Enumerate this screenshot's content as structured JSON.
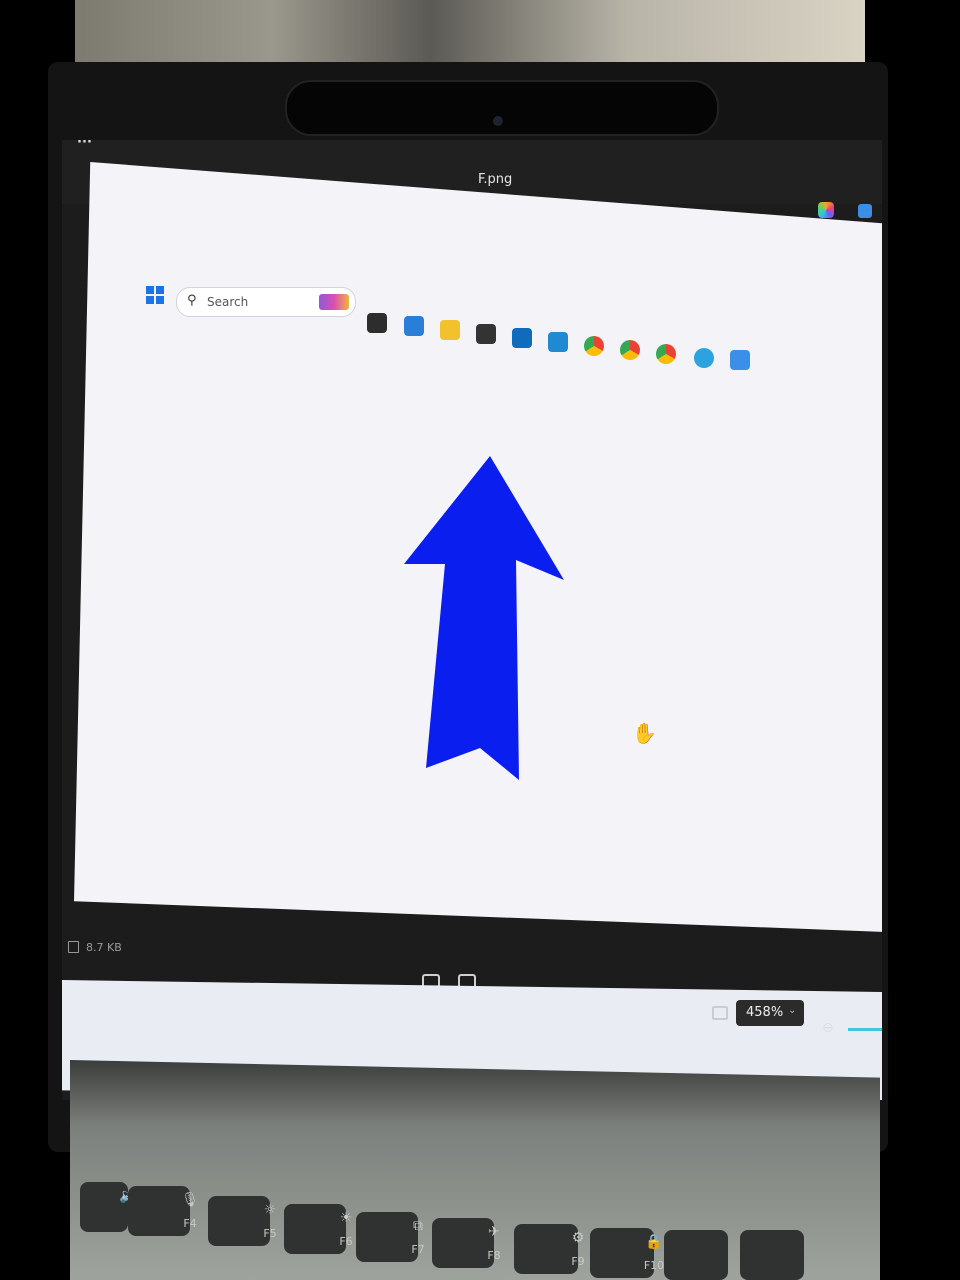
{
  "window": {
    "more_label": "···",
    "file_name": "F.png"
  },
  "status": {
    "file_size": "8.7 KB"
  },
  "zoom": {
    "value": "458%",
    "chevron": "⌄"
  },
  "taskbar": {
    "search_placeholder": "Search",
    "apps": [
      "file-explorer",
      "terminal",
      "outlook",
      "vscode",
      "chrome",
      "chrome-profile-m",
      "chrome-profile-p",
      "telegram",
      "photos"
    ]
  },
  "keyboard": {
    "keys": [
      "F4",
      "F5",
      "F6",
      "F7",
      "F8",
      "F9",
      "F10"
    ]
  },
  "colors": {
    "arrow": "#0a1ef0",
    "accent": "#1a73e8"
  }
}
